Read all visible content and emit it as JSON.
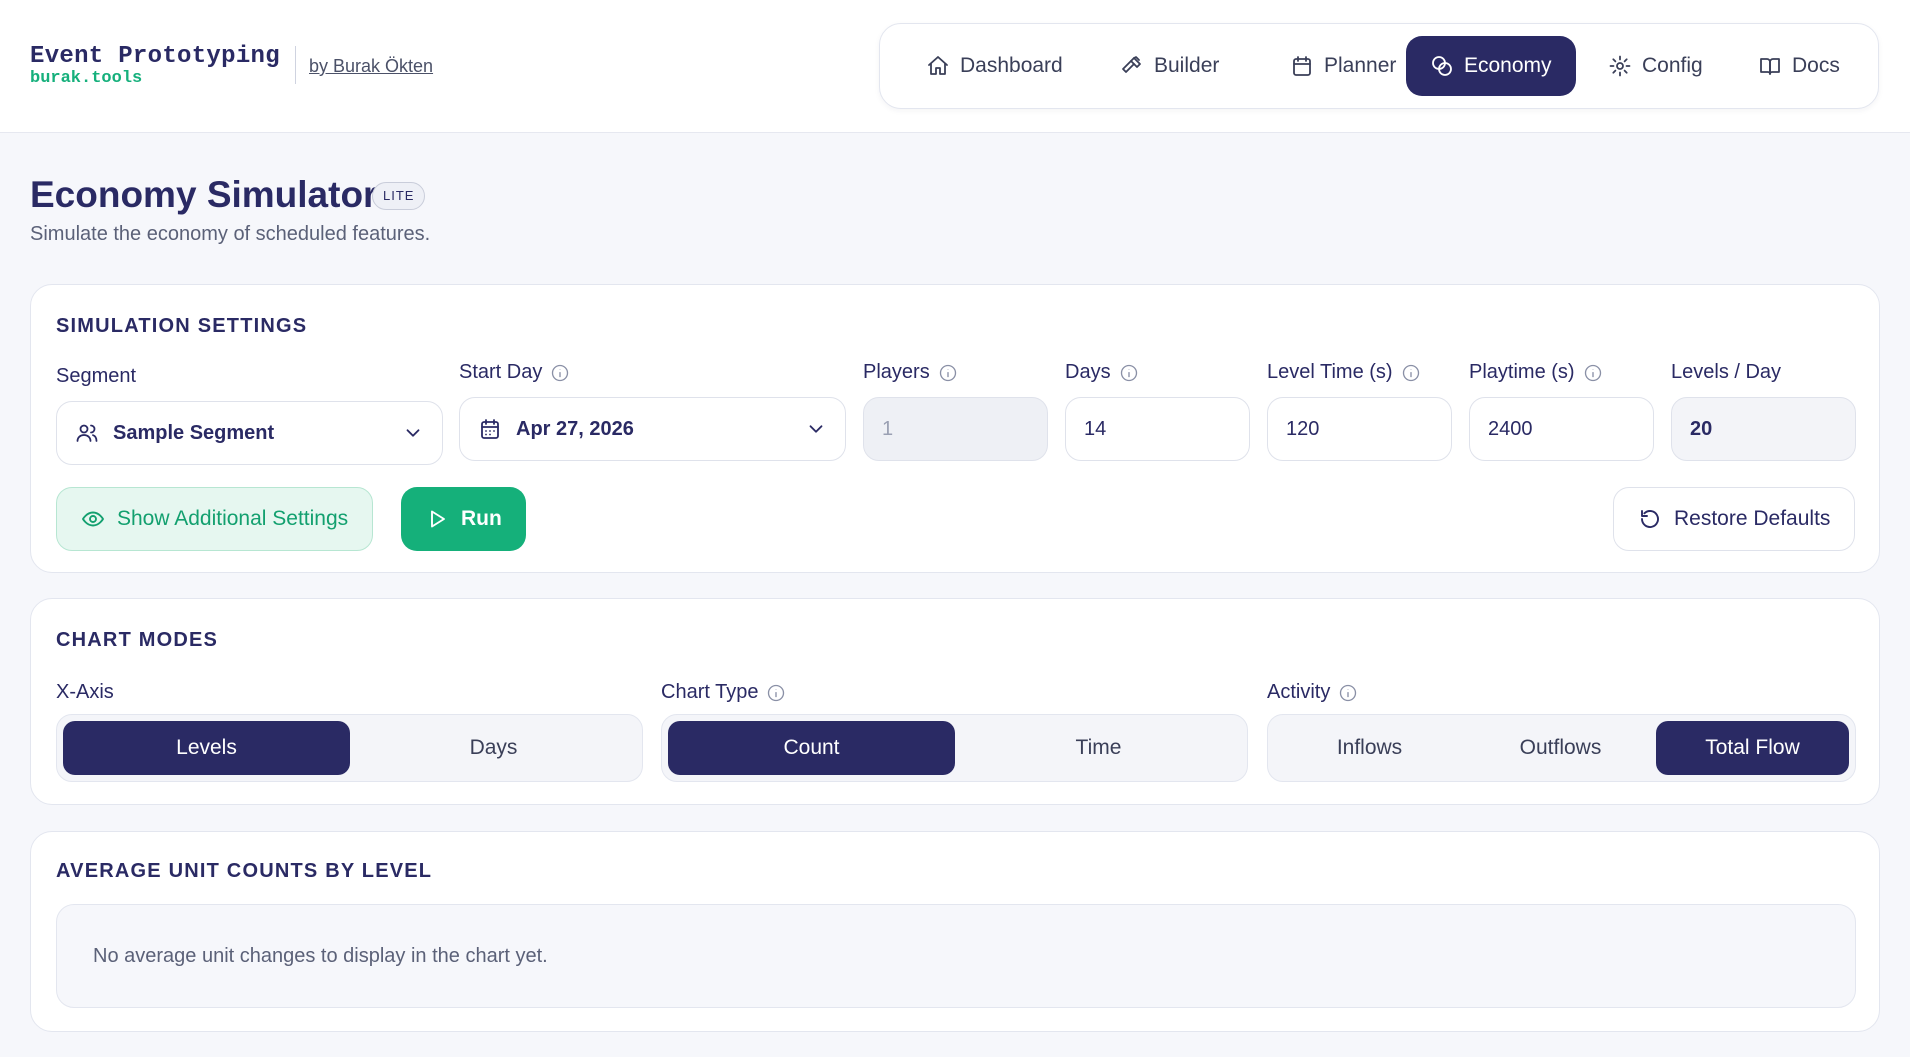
{
  "brand": {
    "title": "Event Prototyping",
    "subtitle": "burak.tools",
    "author": "by Burak Ökten"
  },
  "nav": {
    "items": [
      {
        "label": "Dashboard",
        "icon": "home-icon"
      },
      {
        "label": "Builder",
        "icon": "hammer-icon"
      },
      {
        "label": "Planner",
        "icon": "calendar-icon"
      },
      {
        "label": "Economy",
        "icon": "coins-icon",
        "active": true
      },
      {
        "label": "Config",
        "icon": "gear-icon"
      },
      {
        "label": "Docs",
        "icon": "book-icon"
      }
    ]
  },
  "page": {
    "title": "Economy Simulator",
    "badge": "LITE",
    "subtitle": "Simulate the economy of scheduled features."
  },
  "settings": {
    "title": "SIMULATION SETTINGS",
    "segment": {
      "label": "Segment",
      "value": "Sample Segment"
    },
    "start_day": {
      "label": "Start Day",
      "value": "Apr 27, 2026"
    },
    "players": {
      "label": "Players",
      "value": "1"
    },
    "days": {
      "label": "Days",
      "value": "14"
    },
    "level_time": {
      "label": "Level Time (s)",
      "value": "120"
    },
    "playtime": {
      "label": "Playtime (s)",
      "value": "2400"
    },
    "levels_per_day": {
      "label": "Levels / Day",
      "value": "20"
    },
    "show_additional_label": "Show Additional Settings",
    "run_label": "Run",
    "restore_label": "Restore Defaults"
  },
  "chart_modes": {
    "title": "CHART MODES",
    "x_axis": {
      "label": "X-Axis",
      "options": [
        "Levels",
        "Days"
      ],
      "selected": "Levels"
    },
    "chart_type": {
      "label": "Chart Type",
      "options": [
        "Count",
        "Time"
      ],
      "selected": "Count"
    },
    "activity": {
      "label": "Activity",
      "options": [
        "Inflows",
        "Outflows",
        "Total Flow"
      ],
      "selected": "Total Flow"
    }
  },
  "avg_units": {
    "title": "AVERAGE UNIT COUNTS BY LEVEL",
    "empty_message": "No average unit changes to display in the chart yet."
  },
  "colors": {
    "navy": "#2a2a64",
    "green": "#15b07a",
    "muted": "#5b6178"
  }
}
